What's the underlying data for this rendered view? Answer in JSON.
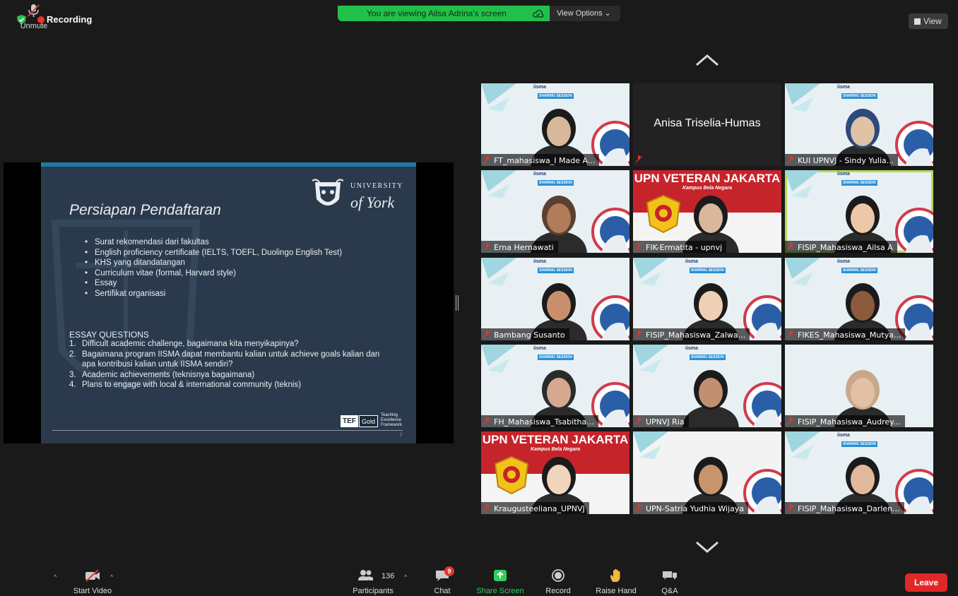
{
  "top": {
    "recording_label": "Recording",
    "viewing_banner": "You are viewing Ailsa Adrina's screen",
    "view_options": "View Options ⌄",
    "view_button": "View"
  },
  "slide": {
    "title": "Persiapan Pendaftaran",
    "logo_university": "UNIVERSITY",
    "logo_of_york": "of York",
    "bullets": [
      "Surat rekomendasi dari fakultas",
      "English proficiency certificate (IELTS, TOEFL, Duolingo English Test)",
      "KHS yang ditandatangan",
      "Curriculum vitae (formal, Harvard style)",
      "Essay",
      "Sertifikat organisasi"
    ],
    "essay_heading": "ESSAY QUESTIONS",
    "essay_items": [
      {
        "n": "1.",
        "text": "Difficult academic challenge, bagaimana kita menyikapinya?"
      },
      {
        "n": "2.",
        "text": "Bagaimana program IISMA dapat membantu kalian untuk achieve goals kalian dan apa kontribusi kalian untuk IISMA sendiri?"
      },
      {
        "n": "3.",
        "text": "Academic achievements (teknisnya bagaimana)"
      },
      {
        "n": "4.",
        "text": "Plans to engage with local & international community (teknis)"
      }
    ],
    "tef_label": "TEF",
    "tef_gold": "Gold",
    "tef_small": "Teaching Excellence Framework",
    "page_number": "7"
  },
  "gallery": {
    "banner_brand": "iisma",
    "banner_session": "SHARING SESSION",
    "upn_title": "UPN VETERAN JAKARTA",
    "upn_subtitle": "Kampus Bela Negara",
    "participants": [
      {
        "name": "FT_mahasiswa_I Made A..."
      },
      {
        "name": "Anisa Triselia-Humas"
      },
      {
        "name": "KUI UPNVJ - Sindy Yulia..."
      },
      {
        "name": "Erna Hernawati"
      },
      {
        "name": "FIK-Ermatita - upnvj"
      },
      {
        "name": "FISIP_Mahasiswa_Ailsa A"
      },
      {
        "name": "Bambang Susanto"
      },
      {
        "name": "FISIP_Mahasiswa_Zalwa..."
      },
      {
        "name": "FIKES_Mahasiswa_Mutya..."
      },
      {
        "name": "FH_Mahasiswa_Tsabitha..."
      },
      {
        "name": "UPNVJ Ria"
      },
      {
        "name": "FISIP_Mahasiswa_Audrey..."
      },
      {
        "name": "Kraugusteeliana_UPNVJ"
      },
      {
        "name": "UPN-Satria Yudhia Wijaya"
      },
      {
        "name": "FISIP_Mahasiswa_Darlen..."
      }
    ]
  },
  "toolbar": {
    "unmute": "Unmute",
    "start_video": "Start Video",
    "participants": "Participants",
    "participant_count": "136",
    "chat": "Chat",
    "chat_badge": "9",
    "share_screen": "Share Screen",
    "record": "Record",
    "raise_hand": "Raise Hand",
    "qa": "Q&A",
    "leave": "Leave"
  },
  "colors": {
    "banner_green": "#22c04a",
    "recording_red": "#e5352b",
    "leave_red": "#e02828",
    "slide_bg": "#2a3a4c",
    "active_speaker": "#b6d95a",
    "upn_red": "#c6242b"
  }
}
